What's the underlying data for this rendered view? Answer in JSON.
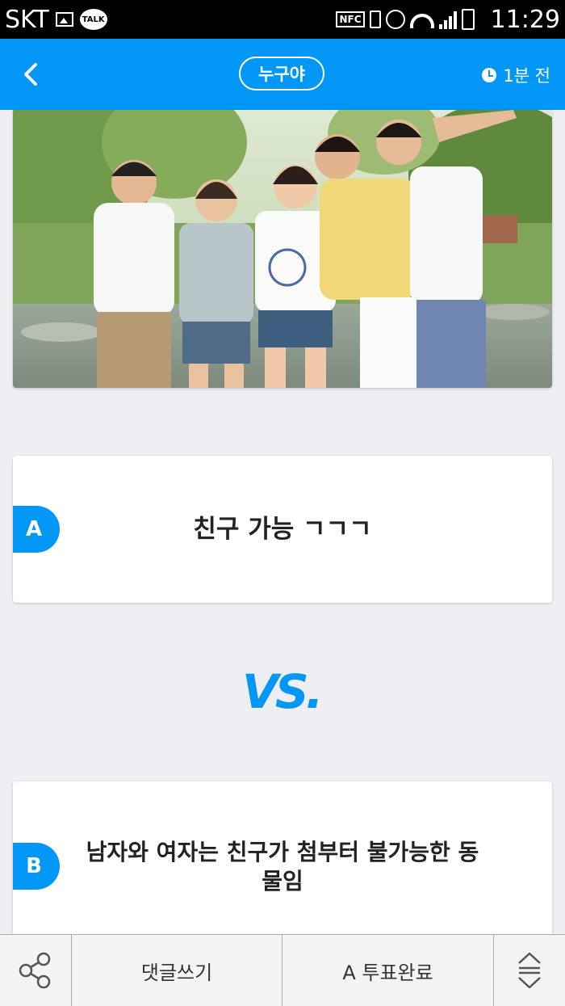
{
  "status_bar": {
    "carrier": "SKT",
    "talk_badge": "TALK",
    "nfc": "NFC",
    "time": "11:29"
  },
  "header": {
    "title": "누구야",
    "time_ago": "1분 전"
  },
  "options": {
    "a": {
      "badge": "A",
      "text": "친구 가능 ㄱㄱㄱ"
    },
    "b": {
      "badge": "B",
      "text": "남자와 여자는 친구가 첨부터 불가능한 동물임"
    }
  },
  "vs_label": "VS.",
  "toolbar": {
    "comment_label": "댓글쓰기",
    "vote_label": "A 투표완료"
  },
  "colors": {
    "accent": "#0197f6",
    "background": "#efeef3"
  },
  "icons": [
    "back-arrow-icon",
    "clock-icon",
    "share-icon",
    "sort-icon"
  ]
}
